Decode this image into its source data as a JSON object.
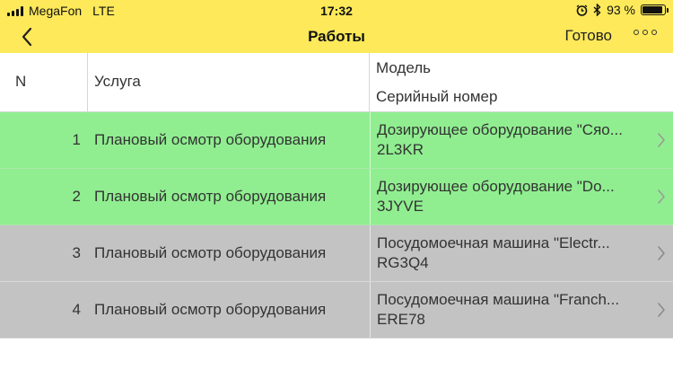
{
  "status_bar": {
    "carrier": "MegaFon",
    "network": "LTE",
    "time": "17:32",
    "battery": "93 %"
  },
  "nav": {
    "title": "Работы",
    "done_label": "Готово",
    "back_icon": "chevron-left-icon",
    "more_icon": "more-dots-icon"
  },
  "table": {
    "headers": {
      "n": "N",
      "service": "Услуга",
      "model": "Модель",
      "serial": "Серийный номер"
    },
    "rows": [
      {
        "n": "1",
        "service": "Плановый осмотр оборудования",
        "model": "Дозирующее оборудование \"Сяо...",
        "serial": "2L3KR",
        "status_color": "#90ee90"
      },
      {
        "n": "2",
        "service": "Плановый осмотр оборудования",
        "model": "Дозирующее оборудование \"Do...",
        "serial": "3JYVE",
        "status_color": "#90ee90"
      },
      {
        "n": "3",
        "service": "Плановый осмотр оборудования",
        "model": "Посудомоечная машина \"Electr...",
        "serial": "RG3Q4",
        "status_color": "#c3c3c3"
      },
      {
        "n": "4",
        "service": "Плановый осмотр оборудования",
        "model": "Посудомоечная машина \"Franch...",
        "serial": "ERE78",
        "status_color": "#c3c3c3"
      }
    ]
  },
  "colors": {
    "accent": "#fde95a",
    "done_row": "#90ee90",
    "pending_row": "#c3c3c3"
  }
}
